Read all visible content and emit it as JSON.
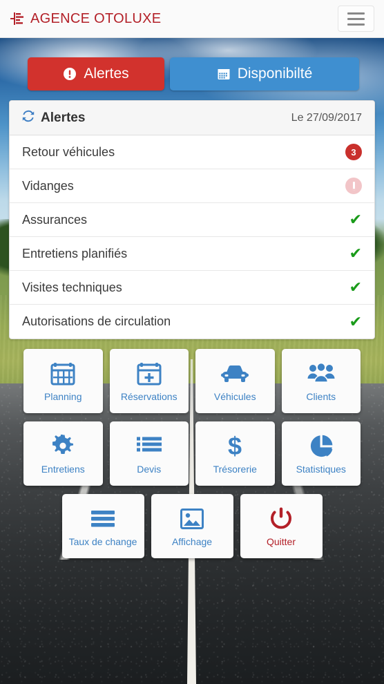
{
  "header": {
    "brand": "AGENCE OTOLUXE",
    "logo_icon": "chart-bars-icon",
    "menu_icon": "hamburger-menu-icon"
  },
  "tabs": [
    {
      "label": "Alertes",
      "icon": "exclamation-circle-icon",
      "active": true,
      "color": "#d2322d"
    },
    {
      "label": "Disponibilté",
      "icon": "calendar-icon",
      "active": false,
      "color": "#3f8fd0"
    }
  ],
  "panel": {
    "title": "Alertes",
    "title_icon": "refresh-icon",
    "date": "Le 27/09/2017",
    "rows": [
      {
        "label": "Retour véhicules",
        "status": "badge",
        "value": "3"
      },
      {
        "label": "Vidanges",
        "status": "warning-muted",
        "value": ""
      },
      {
        "label": "Assurances",
        "status": "ok",
        "value": "✔"
      },
      {
        "label": "Entretiens planifiés",
        "status": "ok",
        "value": "✔"
      },
      {
        "label": "Visites techniques",
        "status": "ok",
        "value": "✔"
      },
      {
        "label": "Autorisations de circulation",
        "status": "ok",
        "value": "✔"
      }
    ]
  },
  "tiles": {
    "row1": [
      {
        "label": "Planning",
        "icon": "calendar-grid-icon"
      },
      {
        "label": "Réservations",
        "icon": "calendar-plus-icon"
      },
      {
        "label": "Véhicules",
        "icon": "car-icon"
      },
      {
        "label": "Clients",
        "icon": "users-group-icon"
      }
    ],
    "row2": [
      {
        "label": "Entretiens",
        "icon": "gear-icon"
      },
      {
        "label": "Devis",
        "icon": "list-ul-icon"
      },
      {
        "label": "Trésorerie",
        "icon": "dollar-sign-icon"
      },
      {
        "label": "Statistiques",
        "icon": "pie-chart-icon"
      }
    ],
    "row3": [
      {
        "label": "Taux de change",
        "icon": "bars-icon"
      },
      {
        "label": "Affichage",
        "icon": "image-icon"
      },
      {
        "label": "Quitter",
        "icon": "power-off-icon"
      }
    ]
  },
  "colors": {
    "brand_red": "#b32028",
    "alert_red": "#d2322d",
    "tab_blue": "#3f8fd0",
    "tile_blue": "#3d82c4",
    "check_green": "#1a9b1a",
    "badge_red": "#c9302c"
  }
}
